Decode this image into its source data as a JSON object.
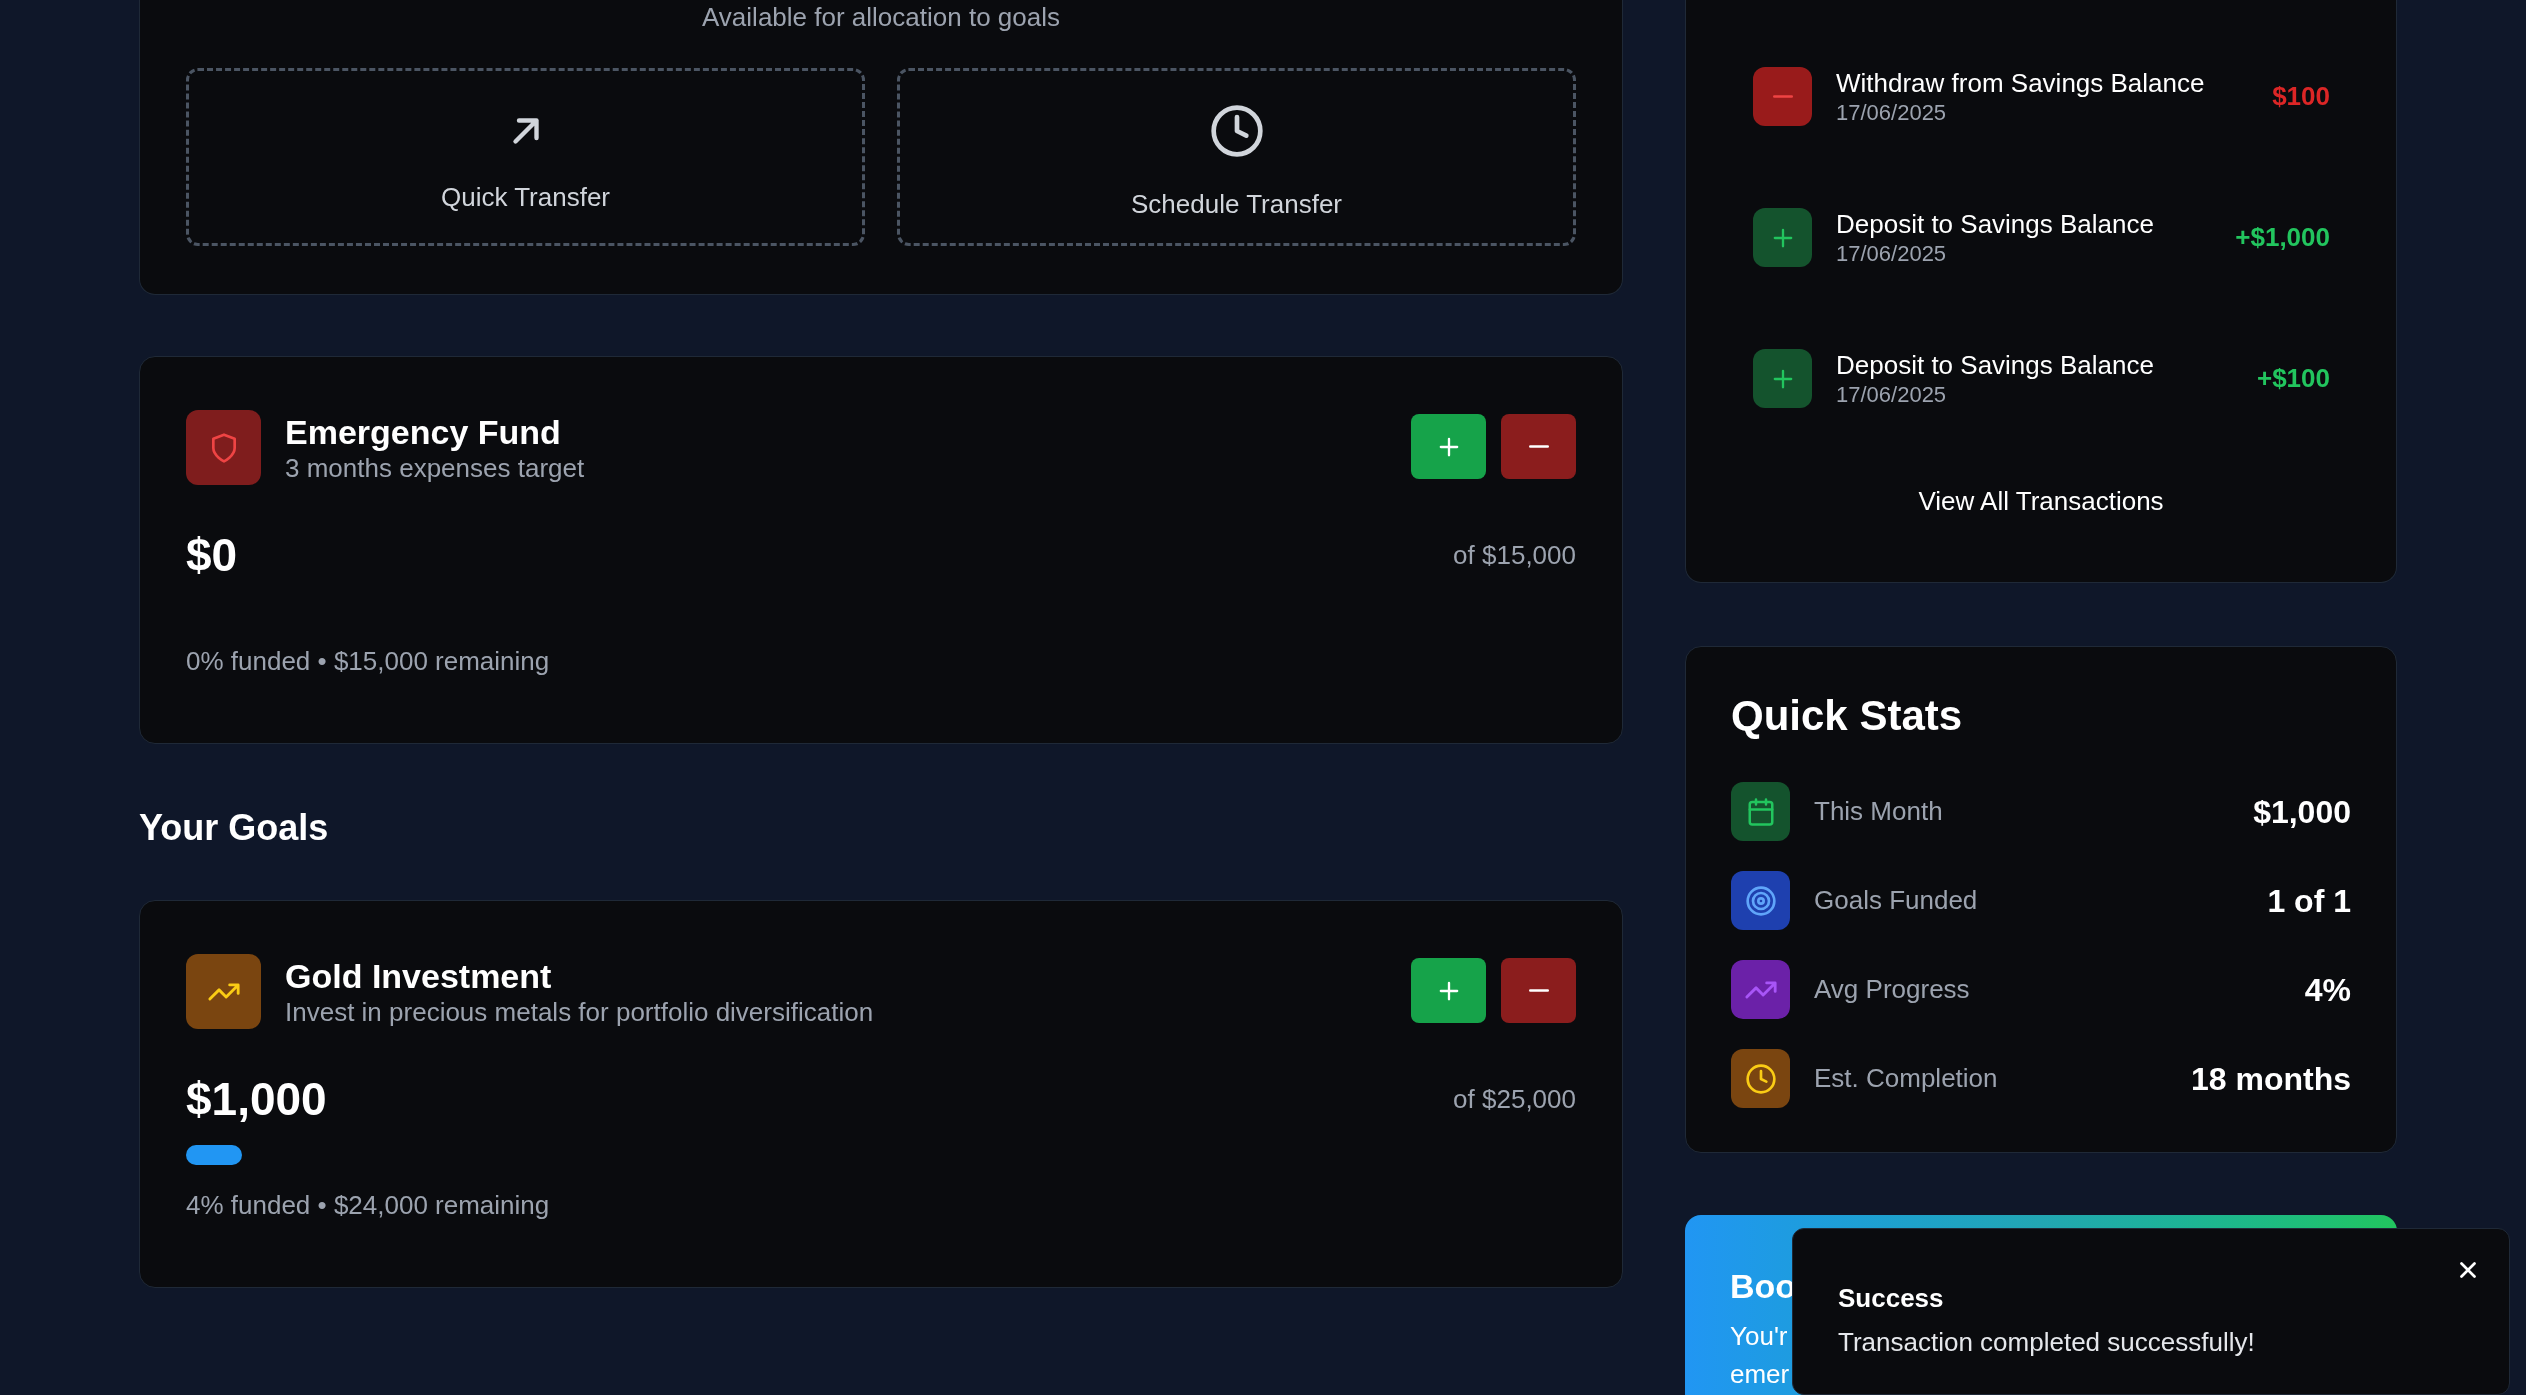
{
  "transfer_panel": {
    "caption": "Available for allocation to goals",
    "actions": [
      {
        "kind": "arrow",
        "label": "Quick Transfer"
      },
      {
        "kind": "clock",
        "label": "Schedule Transfer"
      }
    ]
  },
  "featured_goal": {
    "title": "Emergency Fund",
    "subtitle": "3 months expenses target",
    "amount": "$0",
    "target": "of $15,000",
    "summary": "0% funded • $15,000 remaining"
  },
  "goals_heading": "Your Goals",
  "goals": [
    {
      "title": "Gold Investment",
      "subtitle": "Invest in precious metals for portfolio diversification",
      "amount": "$1,000",
      "target": "of $25,000",
      "level": 0.04,
      "summary": "4% funded • $24,000 remaining"
    }
  ],
  "transactions": {
    "items": [
      {
        "kind": "withdraw",
        "title": "Withdraw from Savings Balance",
        "date": "17/06/2025",
        "amount": "$100"
      },
      {
        "kind": "deposit",
        "title": "Deposit to Savings Balance",
        "date": "17/06/2025",
        "amount": "+$1,000"
      },
      {
        "kind": "deposit",
        "title": "Deposit to Savings Balance",
        "date": "17/06/2025",
        "amount": "+$100"
      }
    ],
    "link": "View All Transactions"
  },
  "quick_stats": {
    "title": "Quick Stats",
    "rows": [
      {
        "label": "This Month",
        "value": "$1,000"
      },
      {
        "label": "Goals Funded",
        "value": "1 of 1"
      },
      {
        "label": "Avg Progress",
        "value": "4%"
      },
      {
        "label": "Est. Completion",
        "value": "18 months"
      }
    ]
  },
  "boost_card": {
    "title": "Boo",
    "lines": [
      "You'r",
      "emer"
    ]
  },
  "toast": {
    "title": "Success",
    "message": "Transaction completed successfully!"
  }
}
